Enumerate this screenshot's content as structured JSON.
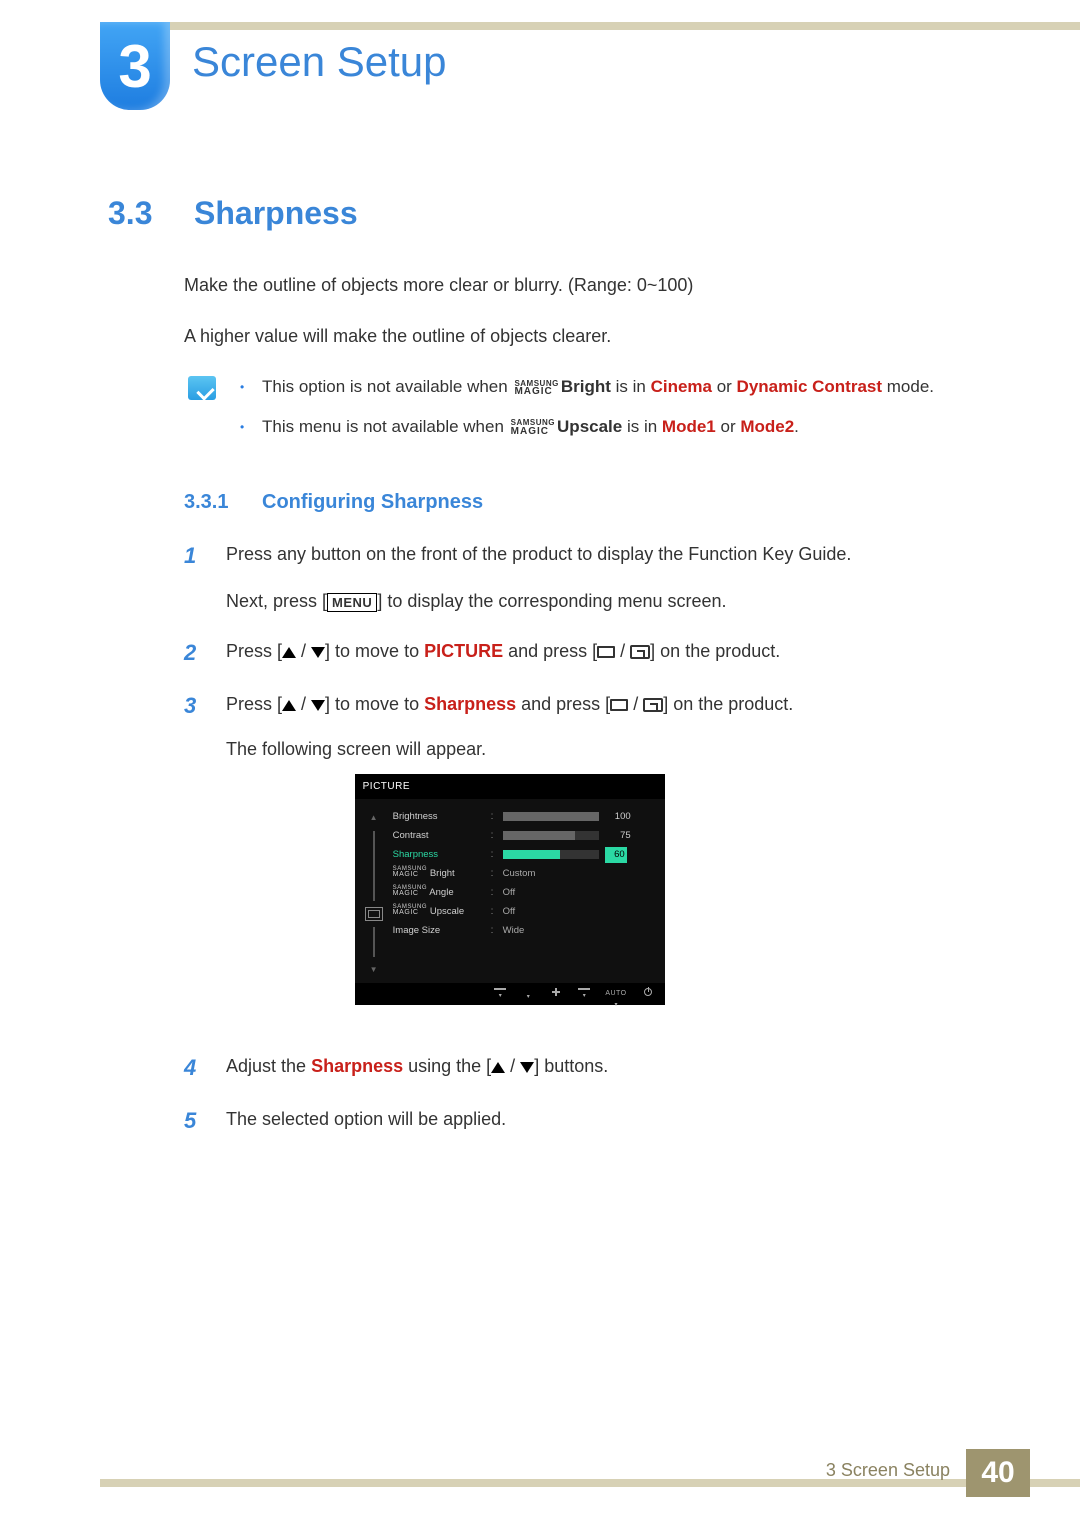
{
  "chapter": {
    "number": "3",
    "title": "Screen Setup"
  },
  "section": {
    "number": "3.3",
    "title": "Sharpness"
  },
  "intro": {
    "p1": "Make the outline of objects more clear or blurry. (Range: 0~100)",
    "p2": "A higher value will make the outline of objects clearer."
  },
  "notes": {
    "n1_pre": "This option is not available when ",
    "n1_term": "Bright",
    "n1_mid": " is in ",
    "n1_a": "Cinema",
    "n1_or": " or ",
    "n1_b": "Dynamic Contrast",
    "n1_post": " mode.",
    "n2_pre": "This menu is not available when ",
    "n2_term": "Upscale",
    "n2_mid": " is in ",
    "n2_a": "Mode1",
    "n2_or": " or ",
    "n2_b": "Mode2",
    "n2_post": "."
  },
  "magic": {
    "top": "SAMSUNG",
    "bottom": "MAGIC"
  },
  "subsection": {
    "number": "3.3.1",
    "title": "Configuring Sharpness"
  },
  "steps": {
    "s1a": "Press any button on the front of the product to display the Function Key Guide.",
    "s1b_pre": "Next, press [",
    "s1b_menu": "MENU",
    "s1b_post": "] to display the corresponding menu screen.",
    "s2_pre": "Press [",
    "s2_mid1": "] to move to ",
    "s2_target": "PICTURE",
    "s2_mid2": " and press [",
    "s2_post": "] on the product.",
    "s3_pre": "Press [",
    "s3_mid1": "] to move to ",
    "s3_target": "Sharpness",
    "s3_mid2": " and press [",
    "s3_post": "] on the product.",
    "s3_b": "The following screen will appear.",
    "s4_pre": "Adjust the ",
    "s4_target": "Sharpness",
    "s4_mid": " using the [",
    "s4_post": "] buttons.",
    "s5": "The selected option will be applied."
  },
  "osd": {
    "title": "PICTURE",
    "rows": [
      {
        "label": "Brightness",
        "type": "bar",
        "value": 100,
        "max": 100,
        "selected": false
      },
      {
        "label": "Contrast",
        "type": "bar",
        "value": 75,
        "max": 100,
        "selected": false
      },
      {
        "label": "Sharpness",
        "type": "bar",
        "value": 60,
        "max": 100,
        "selected": true
      },
      {
        "label": "Bright",
        "prefix": "magic",
        "type": "text",
        "value": "Custom"
      },
      {
        "label": "Angle",
        "prefix": "magic",
        "type": "text",
        "value": "Off"
      },
      {
        "label": "Upscale",
        "prefix": "magic",
        "type": "text",
        "value": "Off"
      },
      {
        "label": "Image Size",
        "type": "text",
        "value": "Wide"
      }
    ],
    "footer_auto": "AUTO"
  },
  "footer": {
    "text": "3  Screen Setup",
    "page": "40"
  }
}
